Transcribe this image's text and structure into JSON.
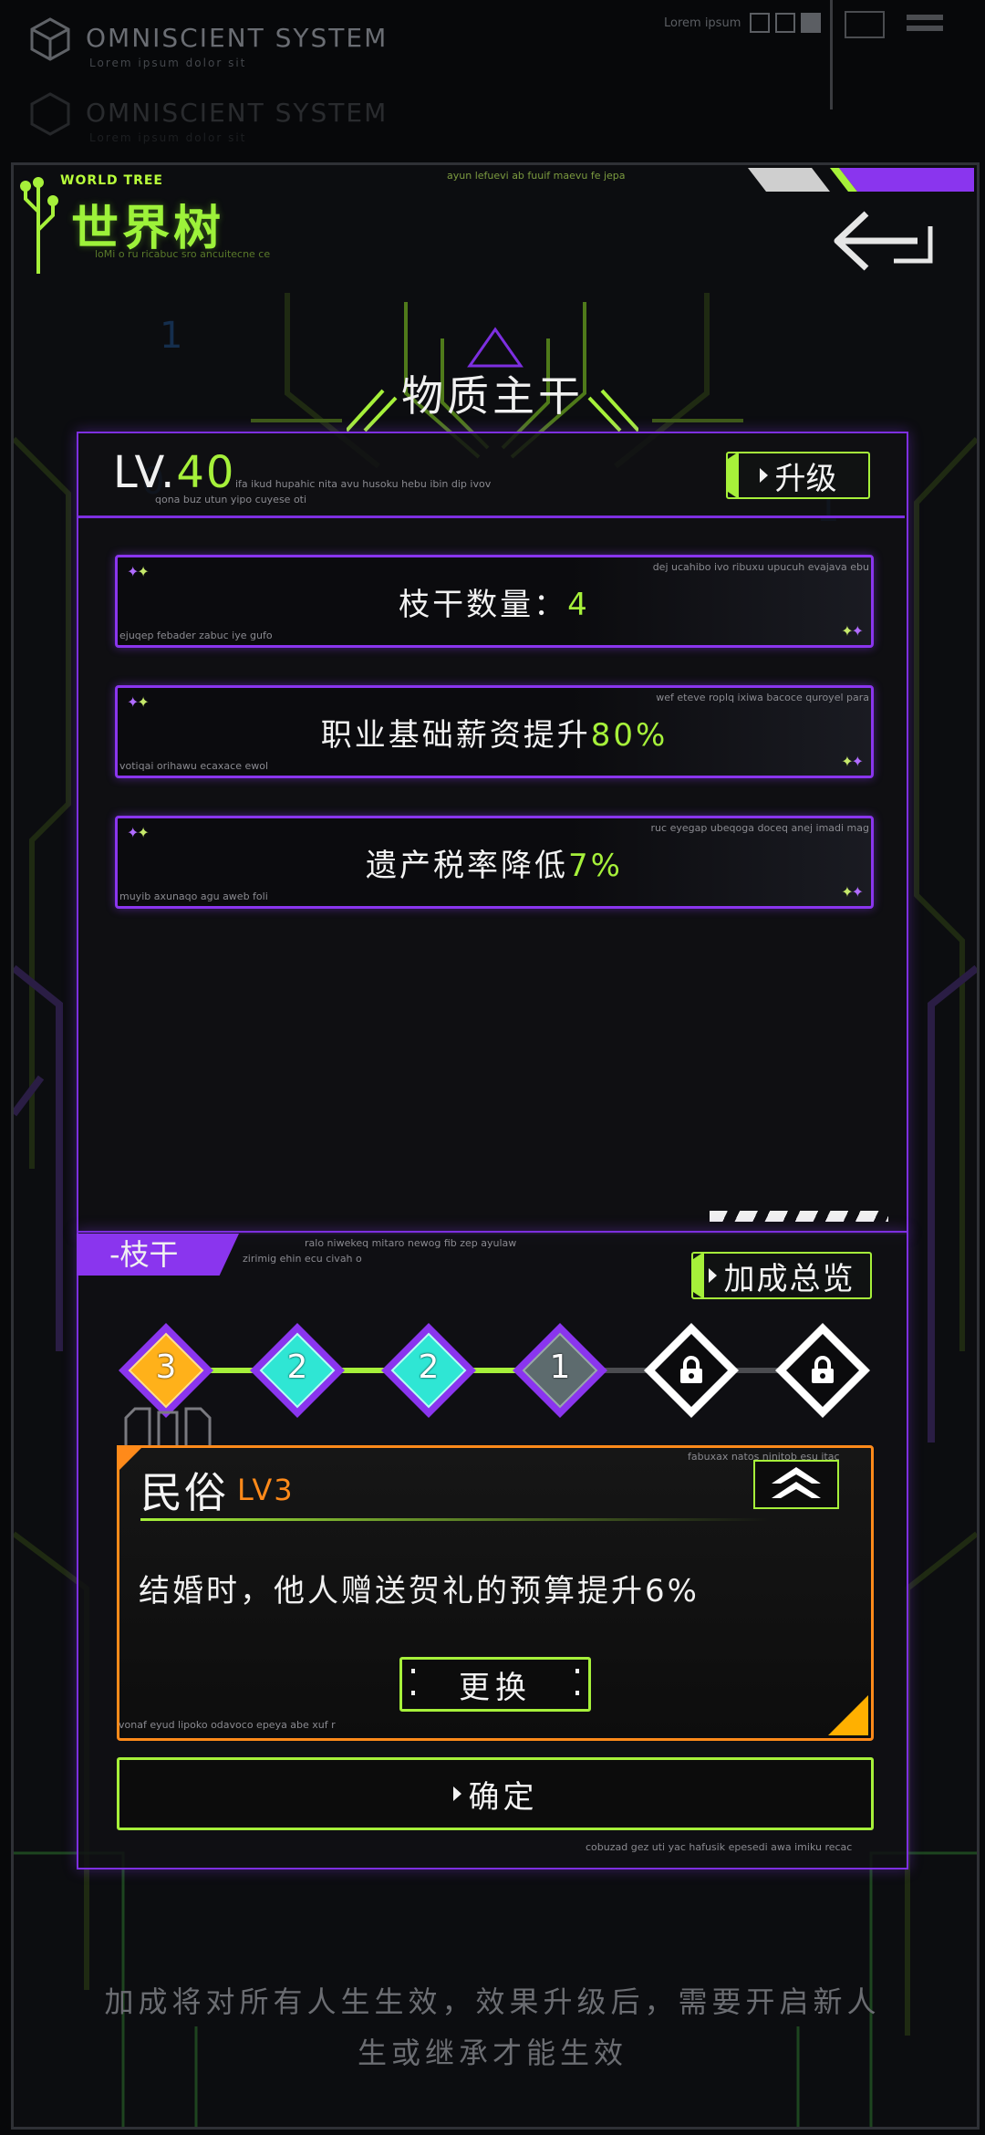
{
  "system": {
    "title": "OMNISCIENT SYSTEM",
    "subtitle": "Lorem ipsum dolor sit",
    "lorem": "Lorem ipsum",
    "ghost_title": "OMNISCIENT SYSTEM",
    "ghost_subtitle": "Lorem ipsum dolor sit"
  },
  "header": {
    "small_title": "WORLD TREE",
    "title": "世界树",
    "subtitle": "loMi o ru ricabuc sro ancuitecne ce",
    "ticker": "ayun lefuevi ab fuuif maevu fe jepa",
    "back_icon": "back-arrow-icon"
  },
  "trunk": {
    "title": "物质主干",
    "level_prefix": "LV.",
    "level": "40",
    "note1": "ifa ikud hupahic nita avu husoku hebu ibin dip ivov",
    "note2": "qona buz utun yipo cuyese oti",
    "upgrade_label": "升级"
  },
  "stats": [
    {
      "label": "枝干数量：",
      "value": "4",
      "note_tr": "dej ucahibo ivo ribuxu upucuh evajava ebu",
      "note_bl": "ejuqep febader zabuc iye gufo"
    },
    {
      "label": "职业基础薪资提升",
      "value": "80%",
      "note_tr": "wef eteve roplq ixiwa bacoce quroyel para",
      "note_bl": "votiqai orihawu ecaxace ewol"
    },
    {
      "label": "遗产税率降低",
      "value": "7%",
      "note_tr": "ruc eyegap ubeqoga doceq anej imadi mag",
      "note_bl": "muyib axunaqo agu aweb foli"
    }
  ],
  "branch": {
    "tag": "-枝干",
    "note1": "ralo niwekeq mitaro newog fib zep ayulaw",
    "note2": "zirimig ehin ecu civah o",
    "bonus_label": "加成总览",
    "nodes": [
      {
        "label": "3",
        "color": "#ffb11a",
        "state": "selected"
      },
      {
        "label": "2",
        "color": "#2fe6d4",
        "state": "unlocked"
      },
      {
        "label": "2",
        "color": "#2fe6d4",
        "state": "unlocked"
      },
      {
        "label": "1",
        "color": "#5d6b6e",
        "state": "unlocked"
      },
      {
        "label": "",
        "color": "#ffffff",
        "state": "locked",
        "icon": "lock-icon"
      },
      {
        "label": "",
        "color": "#ffffff",
        "state": "locked",
        "icon": "lock-icon"
      }
    ]
  },
  "card": {
    "title": "民俗",
    "level": "LV3",
    "note_tr": "fabuxax natos ninitob esu itac",
    "description": "结婚时，他人赠送贺礼的预算提升6%",
    "swap_label": "更换",
    "note_bl": "vonaf eyud lipoko odavoco epeya abe xuf r",
    "collapse_icon": "double-chevron-up-icon"
  },
  "confirm_label": "确定",
  "footer_note": "cobuzad gez uti yac hafusik epesedi awa imiku recac",
  "bottom_text_line1": "加成将对所有人生生效，效果升级后，需要开启新人",
  "bottom_text_line2": "生或继承才能生效",
  "colors": {
    "accent_green": "#a6f03a",
    "accent_purple": "#8a35ee",
    "accent_orange": "#ff8a1a",
    "node_gold": "#ffb11a",
    "node_cyan": "#2fe6d4"
  }
}
